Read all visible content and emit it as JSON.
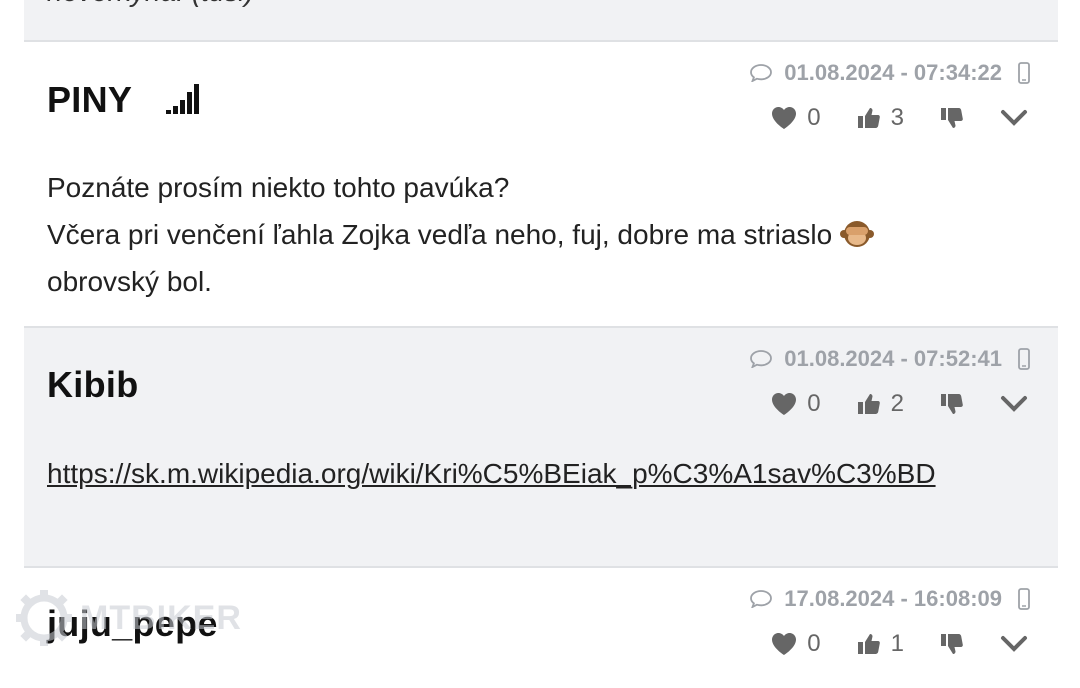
{
  "top_comment": {
    "tail_text": "novorkyna. (tusi)"
  },
  "comments": [
    {
      "author": "PINY",
      "timestamp": "01.08.2024 - 07:34:22",
      "hearts": "0",
      "likes": "3",
      "lines": [
        "Poznáte prosím niekto tohto pavúka?",
        "Včera pri venčení ľahla Zojka vedľa neho, fuj, dobre ma striaslo",
        "obrovský bol."
      ]
    },
    {
      "author": "Kibib",
      "timestamp": "01.08.2024 - 07:52:41",
      "hearts": "0",
      "likes": "2",
      "link": "https://sk.m.wikipedia.org/wiki/Kri%C5%BEiak_p%C3%A1sav%C3%BD"
    },
    {
      "author": "juju_pepe",
      "timestamp": "17.08.2024 - 16:08:09",
      "hearts": "0",
      "likes": "1"
    }
  ],
  "watermark": {
    "text": "MTBIKER"
  },
  "colors": {
    "meta_gray": "#9ea2a8",
    "alt_background": "#f1f2f4",
    "divider": "#dfe1e4"
  },
  "icons": [
    "comment-bubble-icon",
    "mobile-phone-icon",
    "heart-icon",
    "thumbs-up-icon",
    "thumbs-down-icon",
    "chevron-down-icon",
    "signal-bars-icon",
    "monkey-emoji-icon",
    "gear-logo-icon"
  ]
}
